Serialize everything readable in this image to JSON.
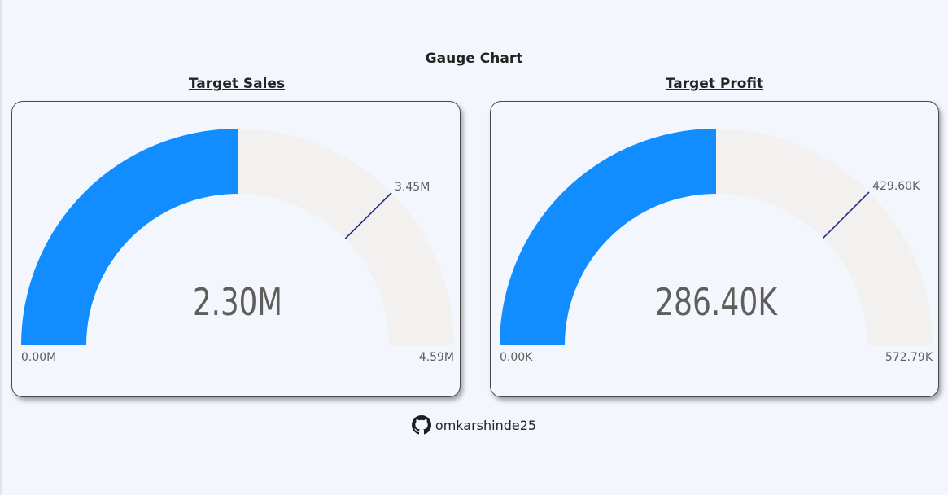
{
  "page": {
    "title": "Gauge Chart"
  },
  "footer": {
    "icon": "github-icon",
    "handle": "omkarshinde25"
  },
  "colors": {
    "fill": "#118dff",
    "track": "#f2f1ef",
    "target_line": "#1d2a8a",
    "value_text": "#605e5c",
    "label_text": "#605e5c"
  },
  "chart_data": [
    {
      "type": "gauge",
      "title": "Target Sales",
      "value": 2.3,
      "value_label": "2.30M",
      "min": 0,
      "min_label": "0.00M",
      "max": 4.59,
      "max_label": "4.59M",
      "target": 3.45,
      "target_label": "3.45M",
      "unit": "M"
    },
    {
      "type": "gauge",
      "title": "Target Profit",
      "value": 286.4,
      "value_label": "286.40K",
      "min": 0,
      "min_label": "0.00K",
      "max": 572.79,
      "max_label": "572.79K",
      "target": 429.6,
      "target_label": "429.60K",
      "unit": "K"
    }
  ]
}
